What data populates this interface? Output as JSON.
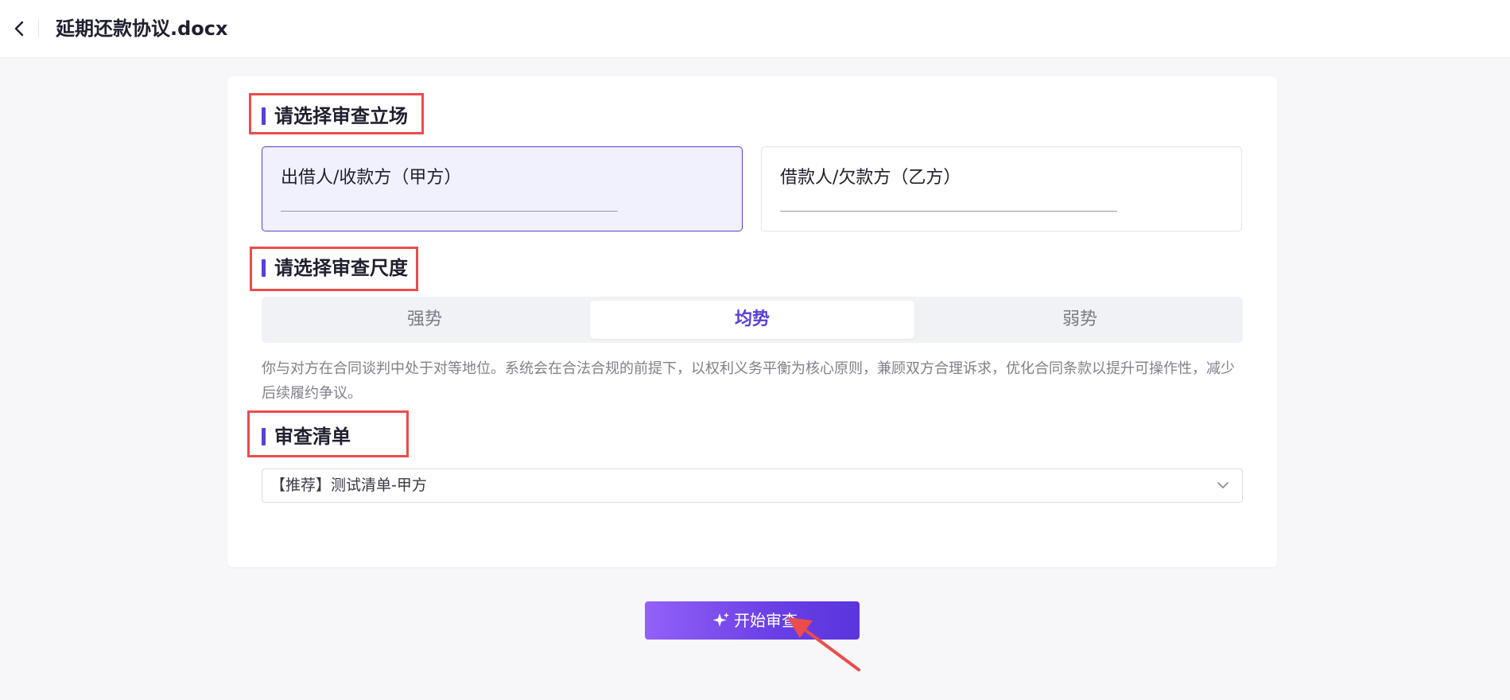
{
  "header": {
    "title": "延期还款协议.docx"
  },
  "sections": {
    "stance_title": "请选择审查立场",
    "scale_title": "请选择审查尺度",
    "checklist_title": "审查清单"
  },
  "stance": {
    "options": [
      {
        "label": "出借人/收款方（甲方）",
        "selected": true
      },
      {
        "label": "借款人/欠款方（乙方）",
        "selected": false
      }
    ]
  },
  "scale": {
    "options": [
      "强势",
      "均势",
      "弱势"
    ],
    "active_index": 1,
    "description": "你与对方在合同谈判中处于对等地位。系统会在合法合规的前提下，以权利义务平衡为核心原则，兼顾双方合理诉求，优化合同条款以提升可操作性，减少后续履约争议。"
  },
  "checklist": {
    "selected_value": "【推荐】测试清单-甲方"
  },
  "actions": {
    "start_label": "开始审查"
  },
  "colors": {
    "accent": "#5b3fd6",
    "annotation": "#ec4c4c",
    "button_gradient_start": "#9461f7",
    "button_gradient_end": "#5a35dc"
  },
  "icons": {
    "back": "chevron-left-icon",
    "dropdown": "chevron-down-icon",
    "start": "sparkle-icon"
  }
}
